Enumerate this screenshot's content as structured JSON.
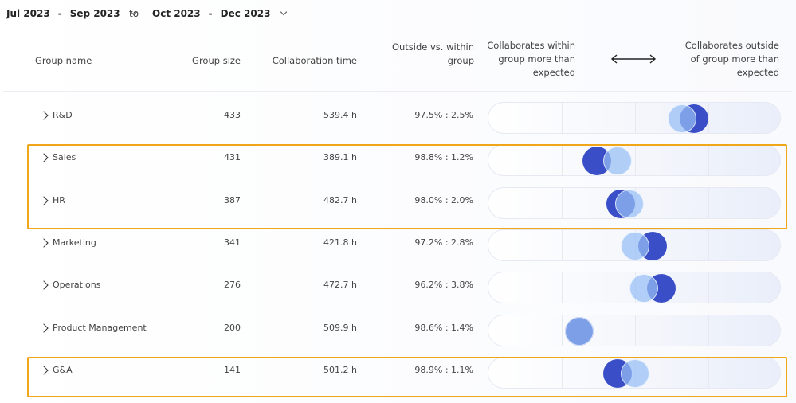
{
  "date_range": {
    "start_from": "Jul 2023",
    "start_to": "Sep 2023",
    "separator": "to",
    "end_from": "Oct 2023",
    "end_to": "Dec 2023"
  },
  "columns": {
    "group_name": "Group name",
    "group_size": "Group size",
    "collab_time": "Collaboration time",
    "ratio_line1": "Outside vs. within",
    "ratio_line2": "group",
    "within_line1": "Collaborates within",
    "within_line2": "group more than",
    "within_line3": "expected",
    "outside_line1": "Collaborates outside",
    "outside_line2": "of group more than",
    "outside_line3": "expected"
  },
  "rows": [
    {
      "name": "R&D",
      "size": "433",
      "time": "539.4 h",
      "ratio": "97.5% : 2.5%",
      "outside_pos": 0.7,
      "within_pos": 0.66,
      "front": "within"
    },
    {
      "name": "Sales",
      "size": "431",
      "time": "389.1 h",
      "ratio": "98.8% : 1.2%",
      "outside_pos": 0.37,
      "within_pos": 0.44,
      "front": "within"
    },
    {
      "name": "HR",
      "size": "387",
      "time": "482.7 h",
      "ratio": "98.0% : 2.0%",
      "outside_pos": 0.45,
      "within_pos": 0.48,
      "front": "within"
    },
    {
      "name": "Marketing",
      "size": "341",
      "time": "421.8 h",
      "ratio": "97.2% : 2.8%",
      "outside_pos": 0.56,
      "within_pos": 0.5,
      "front": "within"
    },
    {
      "name": "Operations",
      "size": "276",
      "time": "472.7 h",
      "ratio": "96.2% : 3.8%",
      "outside_pos": 0.59,
      "within_pos": 0.53,
      "front": "within"
    },
    {
      "name": "Product Management",
      "size": "200",
      "time": "509.9 h",
      "ratio": "98.6% : 1.4%",
      "outside_pos": 0.31,
      "within_pos": 0.31,
      "front": "within"
    },
    {
      "name": "G&A",
      "size": "141",
      "time": "501.2 h",
      "ratio": "98.9% : 1.1%",
      "outside_pos": 0.44,
      "within_pos": 0.5,
      "front": "within"
    }
  ],
  "colors": {
    "outside": "#3a4fc7",
    "within": "#a6c6f5",
    "highlight": "#f0a619"
  },
  "icons": {
    "expand": "chevron-right-icon",
    "dropdown": "chevron-down-icon",
    "arrow": "double-arrow-icon"
  }
}
